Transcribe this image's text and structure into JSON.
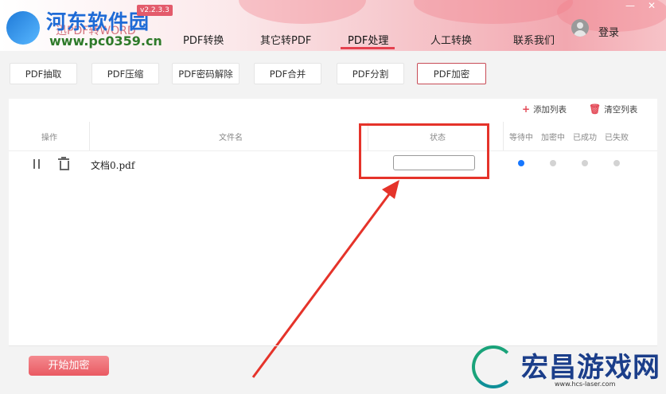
{
  "app": {
    "version": "v2.2.3.3",
    "logo_text": "河东软件园",
    "logo_url": "www.pc0359.cn",
    "logo_sub": "迅PDF转WORD"
  },
  "nav": {
    "tabs": [
      "PDF转换",
      "其它转PDF",
      "PDF处理",
      "人工转换",
      "联系我们"
    ],
    "active_index": 2,
    "login": "登录"
  },
  "subtabs": {
    "items": [
      "PDF抽取",
      "PDF压缩",
      "PDF密码解除",
      "PDF合并",
      "PDF分割",
      "PDF加密"
    ],
    "active_index": 5
  },
  "toolbar": {
    "add_list": "添加列表",
    "clear_list": "清空列表"
  },
  "table": {
    "headers": {
      "action": "操作",
      "filename": "文件名",
      "status": "状态",
      "waiting": "等待中",
      "encrypting": "加密中",
      "success": "已成功",
      "failed": "已失败"
    },
    "rows": [
      {
        "filename": "文档0.pdf",
        "status_value": "",
        "stage": "waiting"
      }
    ]
  },
  "footer": {
    "start_button": "开始加密"
  },
  "watermark": {
    "text": "宏昌游戏网",
    "url": "www.hcs-laser.com"
  },
  "colors": {
    "accent": "#e5414f",
    "highlight": "#e5332a",
    "dot_active": "#1677ff",
    "dot_inactive": "#d3d3d3"
  }
}
